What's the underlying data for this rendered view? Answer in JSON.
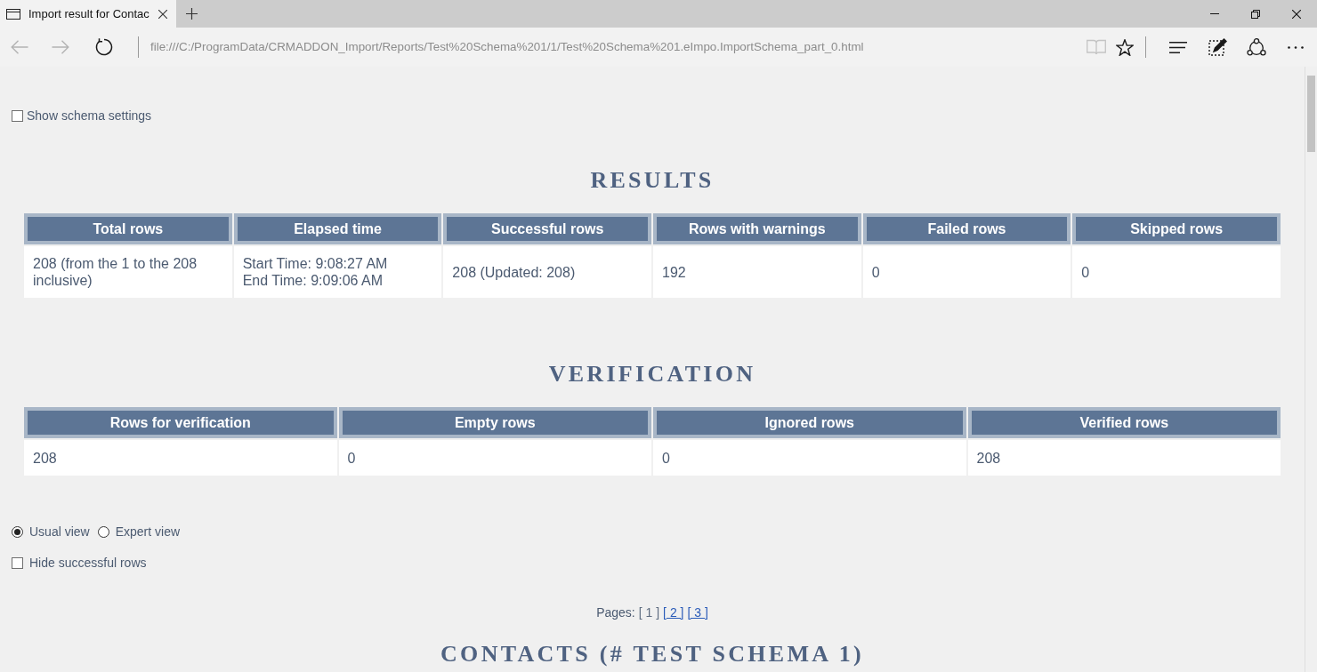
{
  "browser": {
    "tabs": [
      {
        "title": "Import result for Contac",
        "selected": true
      }
    ],
    "nav_buttons": [
      {
        "kind": "back",
        "disabled": true
      },
      {
        "kind": "forward",
        "disabled": true
      },
      {
        "kind": "refresh",
        "disabled": false
      }
    ],
    "address_bar": {
      "url": "file:///C:/ProgramData/CRMADDON_Import/Reports/Test%20Schema%201/1/Test%20Schema%201.eImpo.ImportSchema_part_0.html"
    },
    "page_actions": [
      {
        "kind": "reading-view",
        "disabled": true
      },
      {
        "kind": "favorite",
        "disabled": false
      }
    ],
    "tools": [
      {
        "kind": "hub"
      },
      {
        "kind": "web-note"
      },
      {
        "kind": "share"
      },
      {
        "kind": "more"
      }
    ],
    "window_controls": [
      {
        "kind": "minimize"
      },
      {
        "kind": "restore"
      },
      {
        "kind": "close"
      }
    ]
  },
  "schema_settings": {
    "label": "Show schema settings",
    "checked": false
  },
  "results": {
    "title": "RESULTS",
    "columns": [
      "Total rows",
      "Elapsed time",
      "Successful rows",
      "Rows with warnings",
      "Failed rows",
      "Skipped rows"
    ],
    "row": [
      [
        "208 (from the 1 to the 208 inclusive)"
      ],
      [
        "Start Time: 9:08:27 AM",
        "End Time: 9:09:06 AM"
      ],
      [
        "208 (Updated: 208)"
      ],
      [
        "192"
      ],
      [
        "0"
      ],
      [
        "0"
      ]
    ]
  },
  "verification": {
    "title": "VERIFICATION",
    "columns": [
      "Rows for verification",
      "Empty rows",
      "Ignored rows",
      "Verified rows"
    ],
    "row": [
      [
        "208"
      ],
      [
        "0"
      ],
      [
        "0"
      ],
      [
        "208"
      ]
    ]
  },
  "view_mode": [
    {
      "label": "Usual view",
      "selected": true
    },
    {
      "label": "Expert view",
      "selected": false
    }
  ],
  "hide_successful_rows": {
    "label": "Hide successful rows",
    "checked": false
  },
  "pagination": {
    "label": "Pages:",
    "pages": [
      {
        "label": "[ 1 ]",
        "selected": true
      },
      {
        "label": "[ 2 ]",
        "selected": false
      },
      {
        "label": "[ 3 ]",
        "selected": false
      }
    ]
  },
  "contacts": {
    "title": "CONTACTS (# TEST SCHEMA 1)"
  }
}
